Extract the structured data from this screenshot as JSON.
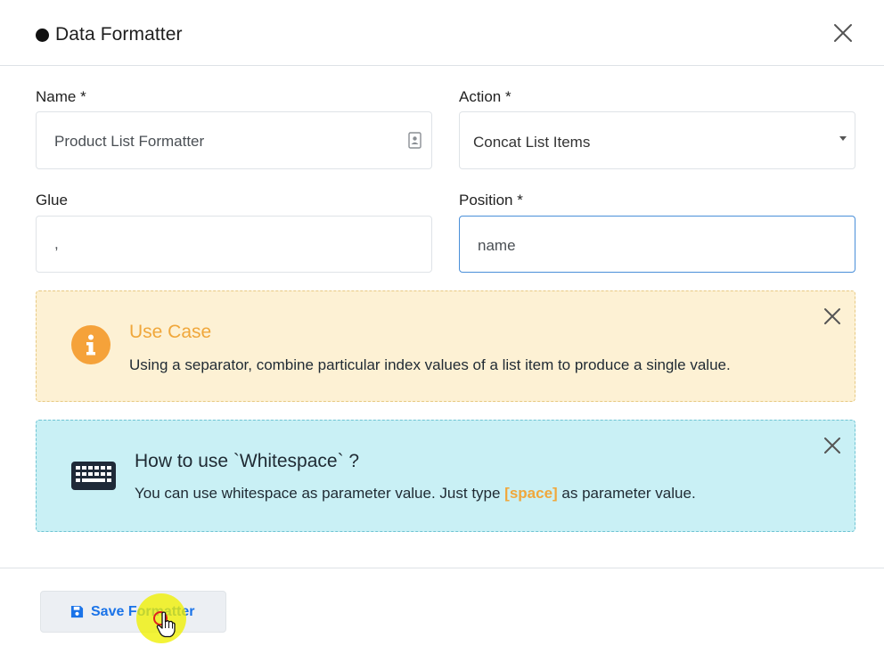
{
  "header": {
    "title": "Data Formatter"
  },
  "form": {
    "name": {
      "label": "Name *",
      "value": "Product List Formatter"
    },
    "action": {
      "label": "Action *",
      "value": "Concat List Items"
    },
    "glue": {
      "label": "Glue",
      "value": ","
    },
    "position": {
      "label": "Position *",
      "value": "name"
    }
  },
  "alerts": {
    "use_case": {
      "title": "Use Case",
      "text": "Using a separator, combine particular index values of a list item to produce a single value."
    },
    "whitespace": {
      "title": "How to use `Whitespace` ?",
      "text_before": "You can use whitespace as parameter value. Just type ",
      "highlight": "[space]",
      "text_after": " as parameter value."
    }
  },
  "footer": {
    "save_label": "Save Formatter"
  },
  "colors": {
    "accent_blue": "#1a73e8",
    "warning_bg": "#fdf1d4",
    "warning_title": "#f0a73b",
    "info_bg": "#c9f0f5",
    "focus_border": "#4a8fd9"
  },
  "icons": {
    "close": "close-icon",
    "contact_card": "contact-card-icon",
    "dropdown": "caret-down-icon",
    "info": "info-circle-icon",
    "keyboard": "keyboard-icon",
    "save": "floppy-disk-icon",
    "cursor": "hand-pointer-icon"
  }
}
